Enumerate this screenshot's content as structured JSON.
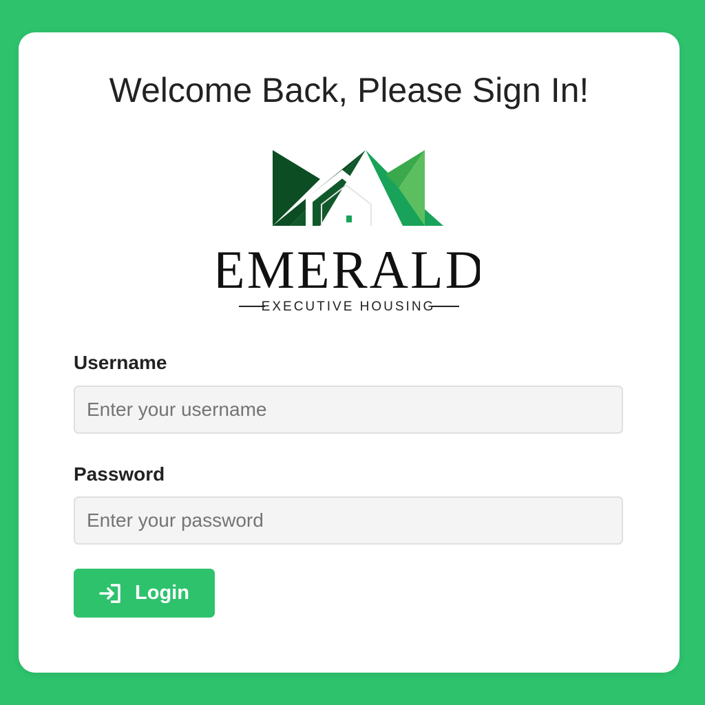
{
  "page": {
    "title": "Welcome Back, Please Sign In!"
  },
  "logo": {
    "name": "EMERALD",
    "tagline": "EXECUTIVE HOUSING",
    "icon": "house-roof-logo",
    "colors": [
      "#0d4d24",
      "#10743a",
      "#19a35a",
      "#5cbf5f"
    ]
  },
  "form": {
    "username": {
      "label": "Username",
      "placeholder": "Enter your username",
      "value": ""
    },
    "password": {
      "label": "Password",
      "placeholder": "Enter your password",
      "value": ""
    },
    "login": {
      "label": "Login",
      "icon": "sign-in-icon"
    }
  },
  "colors": {
    "accent": "#2ec26d",
    "card": "#ffffff",
    "input_bg": "#f3f4f3"
  }
}
